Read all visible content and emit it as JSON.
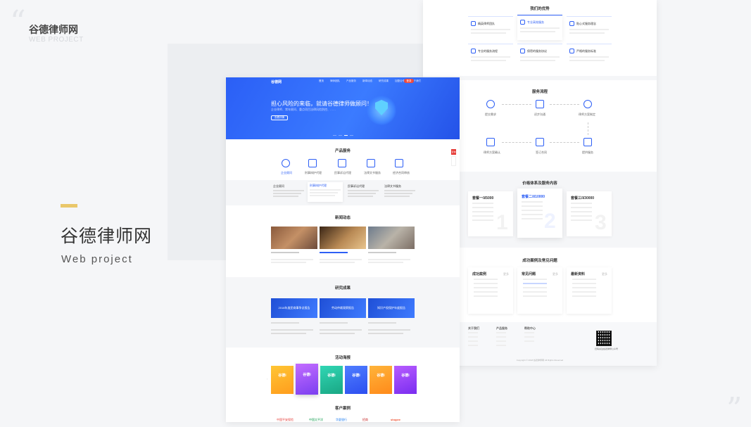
{
  "brand": {
    "title_top": "谷德律师网",
    "subtitle_top": "WEB PROJECT",
    "title_main": "谷德律师网",
    "subtitle_main": "Web project",
    "accent": "#eac76a"
  },
  "site": {
    "logo": "谷德网",
    "nav": [
      "首页",
      "律师团队",
      "产品服务",
      "新闻动态",
      "研究成果",
      "加盟合作",
      "关于我们"
    ],
    "nav_button": "登录",
    "hero_title": "担心风险的来临，就请谷德律师做顾问！",
    "hero_sub": "企业律师、常年顾问、重点项目法律风险防控、……",
    "hero_button": "查看详情",
    "product_title": "产品服务",
    "products": [
      "企业顾问",
      "刑事辩护代理",
      "民事诉讼代理",
      "法律文书服务",
      "经济合同审核"
    ],
    "news_title": "新闻动态",
    "research_title": "研究成果",
    "research_cards": [
      "2018年度民商事争议报告",
      "劳动仲裁观察报告",
      "知识产权保护年度报告"
    ],
    "activity_title": "活动海报",
    "poster_label": "谷德i",
    "client_title": "客户案例",
    "clients": [
      "中国平安保险",
      "中国太平洋",
      "华夏银行",
      "招商",
      "shopee"
    ],
    "side_badge": "咨询"
  },
  "right": {
    "adv_title": "我们的优势",
    "advantages": [
      "精英律师团队",
      "专业高效服务",
      "贴心式服务理念",
      "专业的服务流程",
      "保密的服务协议",
      "严格的服务标准"
    ],
    "process_title": "服务流程",
    "process": [
      "提交需求",
      "初步沟通",
      "律师方案制定",
      "律师方案确认",
      "签订合同",
      "提供服务"
    ],
    "price_title": "价格体系及服务内容",
    "packages": [
      {
        "name": "套餐一",
        "price": "¥5000"
      },
      {
        "name": "套餐二",
        "price": "¥10000"
      },
      {
        "name": "套餐三",
        "price": "¥30000"
      }
    ],
    "cases_title": "成功案例及常见问题",
    "cases": [
      "成功案例",
      "常见问题",
      "最新资料"
    ],
    "more_label": "更多",
    "footer_cols": [
      "关于我们",
      "产品服务",
      "帮助中心"
    ],
    "qr_caption": "扫码关注谷德律师公众号",
    "copyright": "Copyright © 2018 谷德律师网 All Rights Reserved"
  }
}
